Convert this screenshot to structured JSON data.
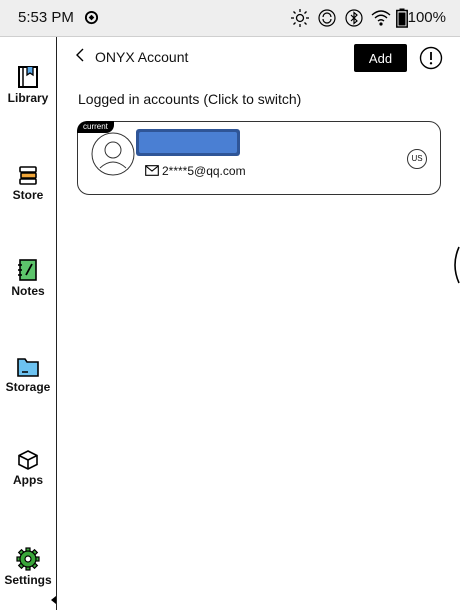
{
  "status_bar": {
    "time": "5:53 PM",
    "battery": "100%",
    "icons": [
      "sync-icon",
      "brightness-icon",
      "refresh-icon",
      "bluetooth-icon",
      "wifi-icon",
      "battery-icon"
    ]
  },
  "sidebar": {
    "items": [
      {
        "label": "Library",
        "icon": "library-icon"
      },
      {
        "label": "Store",
        "icon": "store-icon"
      },
      {
        "label": "Notes",
        "icon": "notes-icon"
      },
      {
        "label": "Storage",
        "icon": "storage-icon"
      },
      {
        "label": "Apps",
        "icon": "apps-icon"
      },
      {
        "label": "Settings",
        "icon": "settings-icon"
      }
    ],
    "active": "Settings",
    "active_color": "#3aa63a"
  },
  "header": {
    "title": "ONYX Account",
    "add_label": "Add"
  },
  "subtitle": "Logged in accounts (Click to switch)",
  "account": {
    "badge": "current",
    "email": "2****5@qq.com",
    "region": "US",
    "redaction_color": "#4a7fd3"
  }
}
